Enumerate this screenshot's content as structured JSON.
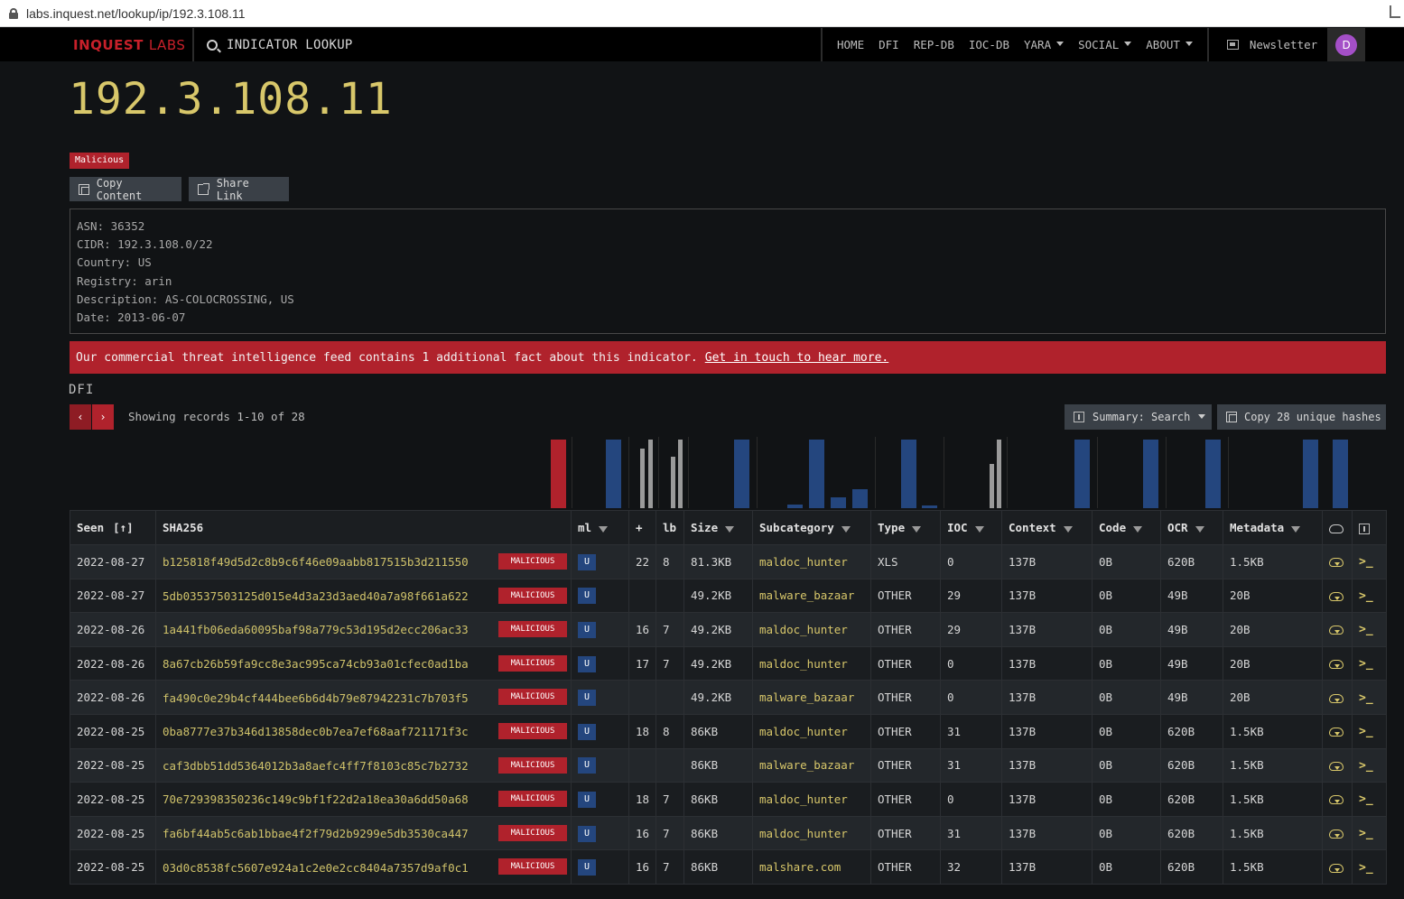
{
  "browser": {
    "url": "labs.inquest.net/lookup/ip/192.3.108.11"
  },
  "nav": {
    "logo_in": "IN",
    "logo_quest": "QUEST",
    "logo_labs": "LABS",
    "search_label": "INDICATOR LOOKUP",
    "links": [
      "HOME",
      "DFI",
      "REP-DB",
      "IOC-DB",
      "YARA",
      "SOCIAL",
      "ABOUT"
    ],
    "newsletter": "Newsletter",
    "avatar": "D"
  },
  "indicator": {
    "ip": "192.3.108.11",
    "verdict": "Malicious",
    "copy_label": "Copy Content",
    "share_label": "Share Link",
    "details": [
      "ASN: 36352",
      "CIDR: 192.3.108.0/22",
      "Country: US",
      "Registry: arin",
      "Description: AS-COLOCROSSING, US",
      "Date: 2013-06-07"
    ]
  },
  "banner": {
    "text": "Our commercial threat intelligence feed contains 1 additional fact about this indicator.",
    "link": "Get in touch to hear more."
  },
  "dfi": {
    "section_label": "DFI",
    "prev": "‹",
    "next": "›",
    "showing": "Showing records 1-10 of 28",
    "summary_btn": "Summary: Search",
    "hashes_btn": "Copy 28 unique hashes",
    "columns": [
      "Seen",
      "SHA256",
      "ml",
      "+",
      "lb",
      "Size",
      "Subcategory",
      "Type",
      "IOC",
      "Context",
      "Code",
      "OCR",
      "Metadata"
    ],
    "seen_sort": "[↑]",
    "rows": [
      {
        "seen": "2022-08-27",
        "sha": "b125818f49d5d2c8b9c6f46e09aabb817515b3d211550",
        "tag": "MALICIOUS",
        "ml": "U",
        "plus": "22",
        "lb": "8",
        "size": "81.3KB",
        "sub": "maldoc_hunter",
        "type": "XLS",
        "ioc": "0",
        "context": "137B",
        "code": "0B",
        "ocr": "620B",
        "meta": "1.5KB"
      },
      {
        "seen": "2022-08-27",
        "sha": "5db03537503125d015e4d3a23d3aed40a7a98f661a622",
        "tag": "MALICIOUS",
        "ml": "U",
        "plus": "",
        "lb": "",
        "size": "49.2KB",
        "sub": "malware_bazaar",
        "type": "OTHER",
        "ioc": "29",
        "context": "137B",
        "code": "0B",
        "ocr": "49B",
        "meta": "20B"
      },
      {
        "seen": "2022-08-26",
        "sha": "1a441fb06eda60095baf98a779c53d195d2ecc206ac33",
        "tag": "MALICIOUS",
        "ml": "U",
        "plus": "16",
        "lb": "7",
        "size": "49.2KB",
        "sub": "maldoc_hunter",
        "type": "OTHER",
        "ioc": "29",
        "context": "137B",
        "code": "0B",
        "ocr": "49B",
        "meta": "20B"
      },
      {
        "seen": "2022-08-26",
        "sha": "8a67cb26b59fa9cc8e3ac995ca74cb93a01cfec0ad1ba",
        "tag": "MALICIOUS",
        "ml": "U",
        "plus": "17",
        "lb": "7",
        "size": "49.2KB",
        "sub": "maldoc_hunter",
        "type": "OTHER",
        "ioc": "0",
        "context": "137B",
        "code": "0B",
        "ocr": "49B",
        "meta": "20B"
      },
      {
        "seen": "2022-08-26",
        "sha": "fa490c0e29b4cf444bee6b6d4b79e87942231c7b703f5",
        "tag": "MALICIOUS",
        "ml": "U",
        "plus": "",
        "lb": "",
        "size": "49.2KB",
        "sub": "malware_bazaar",
        "type": "OTHER",
        "ioc": "0",
        "context": "137B",
        "code": "0B",
        "ocr": "49B",
        "meta": "20B"
      },
      {
        "seen": "2022-08-25",
        "sha": "0ba8777e37b346d13858dec0b7ea7ef68aaf721171f3c",
        "tag": "MALICIOUS",
        "ml": "U",
        "plus": "18",
        "lb": "8",
        "size": "86KB",
        "sub": "maldoc_hunter",
        "type": "OTHER",
        "ioc": "31",
        "context": "137B",
        "code": "0B",
        "ocr": "620B",
        "meta": "1.5KB"
      },
      {
        "seen": "2022-08-25",
        "sha": "caf3dbb51dd5364012b3a8aefc4ff7f8103c85c7b2732",
        "tag": "MALICIOUS",
        "ml": "U",
        "plus": "",
        "lb": "",
        "size": "86KB",
        "sub": "malware_bazaar",
        "type": "OTHER",
        "ioc": "31",
        "context": "137B",
        "code": "0B",
        "ocr": "620B",
        "meta": "1.5KB"
      },
      {
        "seen": "2022-08-25",
        "sha": "70e729398350236c149c9bf1f22d2a18ea30a6dd50a68",
        "tag": "MALICIOUS",
        "ml": "U",
        "plus": "18",
        "lb": "7",
        "size": "86KB",
        "sub": "maldoc_hunter",
        "type": "OTHER",
        "ioc": "0",
        "context": "137B",
        "code": "0B",
        "ocr": "620B",
        "meta": "1.5KB"
      },
      {
        "seen": "2022-08-25",
        "sha": "fa6bf44ab5c6ab1bbae4f2f79d2b9299e5db3530ca447",
        "tag": "MALICIOUS",
        "ml": "U",
        "plus": "16",
        "lb": "7",
        "size": "86KB",
        "sub": "maldoc_hunter",
        "type": "OTHER",
        "ioc": "31",
        "context": "137B",
        "code": "0B",
        "ocr": "620B",
        "meta": "1.5KB"
      },
      {
        "seen": "2022-08-25",
        "sha": "03d0c8538fc5607e924a1c2e0e2cc8404a7357d9af0c1",
        "tag": "MALICIOUS",
        "ml": "U",
        "plus": "16",
        "lb": "7",
        "size": "86KB",
        "sub": "malshare.com",
        "type": "OTHER",
        "ioc": "32",
        "context": "137B",
        "code": "0B",
        "ocr": "620B",
        "meta": "1.5KB"
      }
    ]
  },
  "colors": {
    "accent_red": "#b0222c",
    "hash_yellow": "#cfc26a",
    "ip_yellow": "#d8c76a",
    "histo_blue": "#24467e",
    "histo_gray": "#9a9a9a"
  }
}
